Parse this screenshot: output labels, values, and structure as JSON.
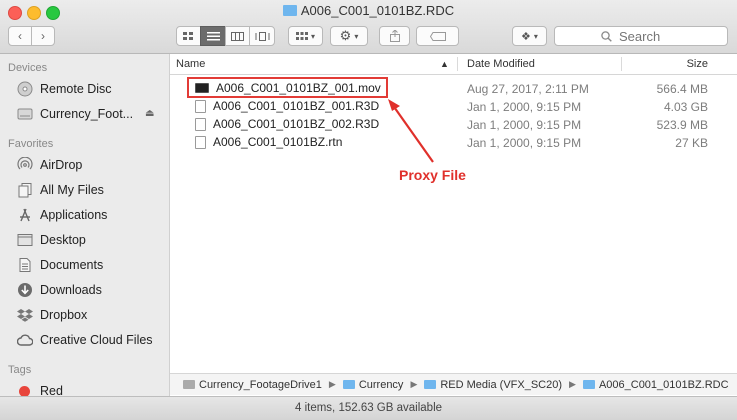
{
  "window": {
    "title": "A006_C001_0101BZ.RDC"
  },
  "toolbar": {
    "back_icon": "chevron-left-icon",
    "forward_icon": "chevron-right-icon",
    "search_placeholder": "Search"
  },
  "sidebar": {
    "sections": [
      {
        "header": "Devices",
        "items": [
          {
            "label": "Remote Disc",
            "icon": "disc-icon"
          },
          {
            "label": "Currency_Foot...",
            "icon": "drive-icon",
            "eject": "⏏"
          }
        ]
      },
      {
        "header": "Favorites",
        "items": [
          {
            "label": "AirDrop",
            "icon": "airdrop-icon"
          },
          {
            "label": "All My Files",
            "icon": "all-files-icon"
          },
          {
            "label": "Applications",
            "icon": "applications-icon"
          },
          {
            "label": "Desktop",
            "icon": "desktop-icon"
          },
          {
            "label": "Documents",
            "icon": "documents-icon"
          },
          {
            "label": "Downloads",
            "icon": "downloads-icon"
          },
          {
            "label": "Dropbox",
            "icon": "dropbox-icon"
          },
          {
            "label": "Creative Cloud Files",
            "icon": "creative-cloud-icon"
          }
        ]
      },
      {
        "header": "Tags",
        "items": [
          {
            "label": "Red",
            "icon": "red-tag-icon",
            "color": "#e8453c"
          }
        ]
      }
    ]
  },
  "columns": {
    "name": "Name",
    "date": "Date Modified",
    "size": "Size"
  },
  "files": [
    {
      "name": "A006_C001_0101BZ_001.mov",
      "date": "Aug 27, 2017, 2:11 PM",
      "size": "566.4 MB",
      "icon": "movie-file-icon"
    },
    {
      "name": "A006_C001_0101BZ_001.R3D",
      "date": "Jan 1, 2000, 9:15 PM",
      "size": "4.03 GB",
      "icon": "document-icon"
    },
    {
      "name": "A006_C001_0101BZ_002.R3D",
      "date": "Jan 1, 2000, 9:15 PM",
      "size": "523.9 MB",
      "icon": "document-icon"
    },
    {
      "name": "A006_C001_0101BZ.rtn",
      "date": "Jan 1, 2000, 9:15 PM",
      "size": "27 KB",
      "icon": "document-icon"
    }
  ],
  "annotation": {
    "label": "Proxy File",
    "color": "#e0302b"
  },
  "path": [
    "Currency_FootageDrive1",
    "Currency",
    "RED Media (VFX_SC20)",
    "A006_C001_0101BZ.RDC"
  ],
  "status": "4 items, 152.63 GB available"
}
